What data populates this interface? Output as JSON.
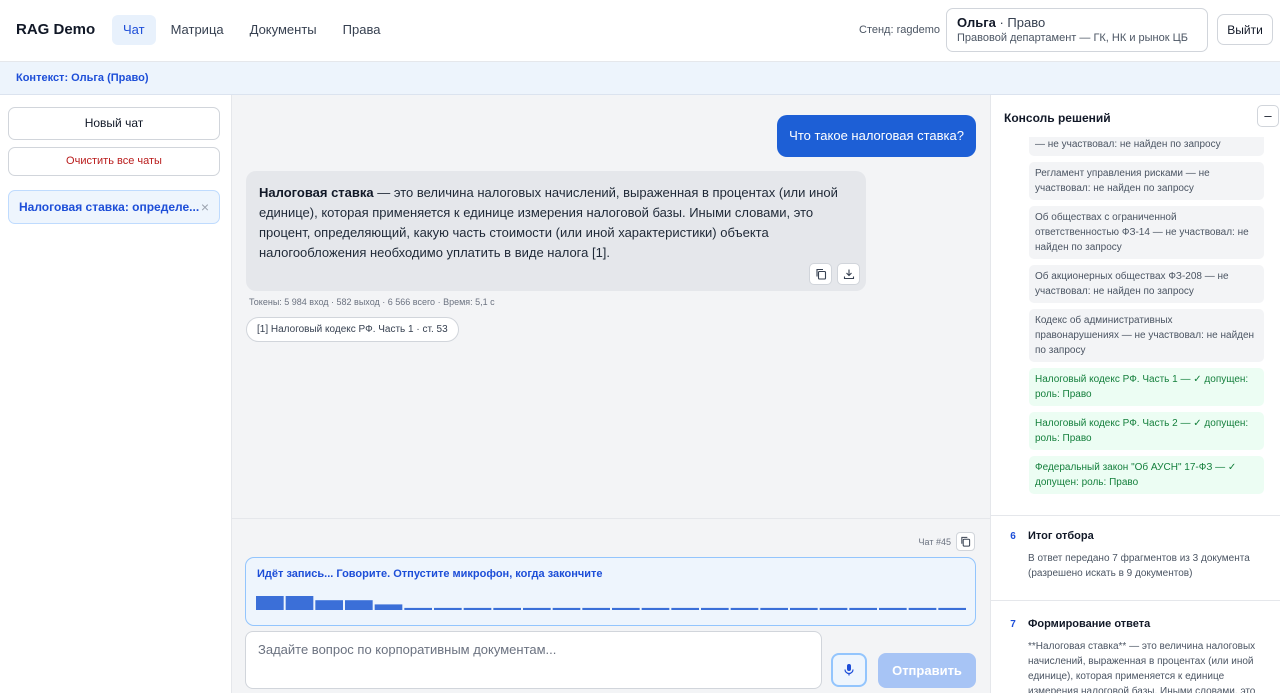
{
  "header": {
    "brand": "RAG Demo",
    "nav": [
      {
        "label": "Чат",
        "active": true
      },
      {
        "label": "Матрица",
        "active": false
      },
      {
        "label": "Документы",
        "active": false
      },
      {
        "label": "Права",
        "active": false
      }
    ],
    "stand": "Стенд: ragdemo",
    "user_name": "Ольга",
    "user_role": " · Право",
    "user_department": "Правовой департамент — ГК, НК и рынок ЦБ",
    "logout_label": "Выйти"
  },
  "context": {
    "label": "Контекст: Ольга (Право)"
  },
  "sidebar": {
    "new_chat_label": "Новый чат",
    "clear_label": "Очистить все чаты",
    "chats": [
      {
        "title": "Налоговая ставка: определе...",
        "close": "×"
      }
    ]
  },
  "chat": {
    "user_message": "Что такое налоговая ставка?",
    "answer_term": "Налоговая ставка",
    "answer_text": " — это величина налоговых начислений, выраженная в процентах (или иной единице), которая применяется к единице измерения налоговой базы. Иными словами, это процент, определяющий, какую часть стоимости (или иной характеристики) объекта налогообложения необходимо уплатить в виде налога [1].",
    "tokens": "Токены: 5 984 вход · 582 выход · 6 566 всего · Время: 5,1 с",
    "citation": "[1] Налоговый кодекс РФ. Часть 1 · ст. 53"
  },
  "composer": {
    "chat_id": "Чат #45",
    "recording_label": "Идёт запись... Говорите. Отпустите микрофон, когда закончите",
    "wave_levels": [
      1.0,
      1.0,
      0.7,
      0.7,
      0.4,
      0.15,
      0.15,
      0.15,
      0.15,
      0.15,
      0.15,
      0.15,
      0.15,
      0.15,
      0.15,
      0.15,
      0.15,
      0.15,
      0.15,
      0.15,
      0.15,
      0.15,
      0.15,
      0.15
    ],
    "placeholder": "Задайте вопрос по корпоративным документам...",
    "send_label": "Отправить"
  },
  "console": {
    "title": "Консоль решений",
    "collapse": "–",
    "documents": [
      {
        "text": "— не участвовал: не найден по запросу",
        "ok": false
      },
      {
        "text": "Регламент управления рисками — не участвовал: не найден по запросу",
        "ok": false
      },
      {
        "text": "Об обществах с ограниченной ответственностью ФЗ-14 — не участвовал: не найден по запросу",
        "ok": false
      },
      {
        "text": "Об акционерных обществах ФЗ-208 — не участвовал: не найден по запросу",
        "ok": false
      },
      {
        "text": "Кодекс об административных правонарушениях — не участвовал: не найден по запросу",
        "ok": false
      },
      {
        "text": "Налоговый кодекс РФ. Часть 1 — ✓ допущен: роль: Право",
        "ok": true
      },
      {
        "text": "Налоговый кодекс РФ. Часть 2 — ✓ допущен: роль: Право",
        "ok": true
      },
      {
        "text": "Федеральный закон \"Об АУСН\" 17-ФЗ — ✓ допущен: роль: Право",
        "ok": true
      }
    ],
    "steps": [
      {
        "num": "6",
        "title": "Итог отбора",
        "text": "В ответ передано 7 фрагментов из 3 документа (разрешено искать в 9 документов)"
      },
      {
        "num": "7",
        "title": "Формирование ответа",
        "text": "**Налоговая ставка** — это величина налоговых начислений, выраженная в процентах (или иной единице), которая применяется к единице измерения налоговой базы. Иными словами, это процент"
      }
    ]
  }
}
